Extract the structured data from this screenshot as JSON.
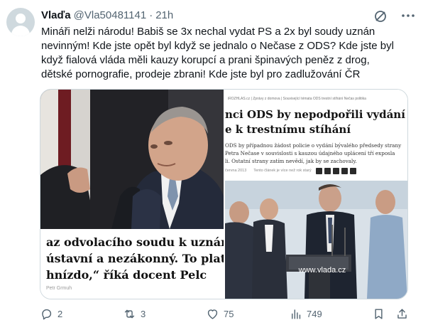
{
  "author": {
    "name": "Vlaďa",
    "handle": "@Vla50481141",
    "separator": "·",
    "time": "21h"
  },
  "tweet_text": {
    "line1": "Mináři nelži národu! Babiš se 3x nechal vydat PS a 2x byl soudy uznán",
    "line2": "nevinným! Kde jste opět byl když se jednalo o Nečase z ODS? Kde jste byl",
    "line3": "když fialová vláda měli kauzy korupcí a prani špinavých peněz z drog,",
    "line4": "dětské pornografie, prodeje zbrani! Kde jste byl pro zadlužování ČR"
  },
  "media": {
    "left": {
      "caption_line1": "az odvolacího soudu k uznání viny",
      "caption_line2": "ústavní a nezákonný. To platí i v ka",
      "caption_line3": "hnízdo,“ říká docent Pelc",
      "credit": "Petr Grmuh"
    },
    "right": {
      "nav": "iROZHLAS.cz  |  Zprávy z domova  |  Související témata  ODS  trestní stíhání  Nečas  politika",
      "headline_line1": "nci ODS by nepodpořili vydání Petra",
      "headline_line2": "e k trestnímu stíhání",
      "perex_line1": "ODS by případnou žádost policie o vydání bývalého předsedy strany",
      "perex_line2": "Petra Nečase v souvislosti s kauzou údajného uplácení tří exposla",
      "perex_line3": "li. Ostatní strany zatím nevědí, jak by se zachovaly.",
      "meta_date": "června 2013",
      "meta_more": "Tento článek je více než rok starý",
      "podium_sign": "www.vlada.cz"
    }
  },
  "actions": {
    "replies": "2",
    "reposts": "3",
    "likes": "75",
    "views": "749"
  },
  "colors": {
    "text": "#0f1419",
    "secondary": "#536471",
    "border": "#cfd9de"
  }
}
